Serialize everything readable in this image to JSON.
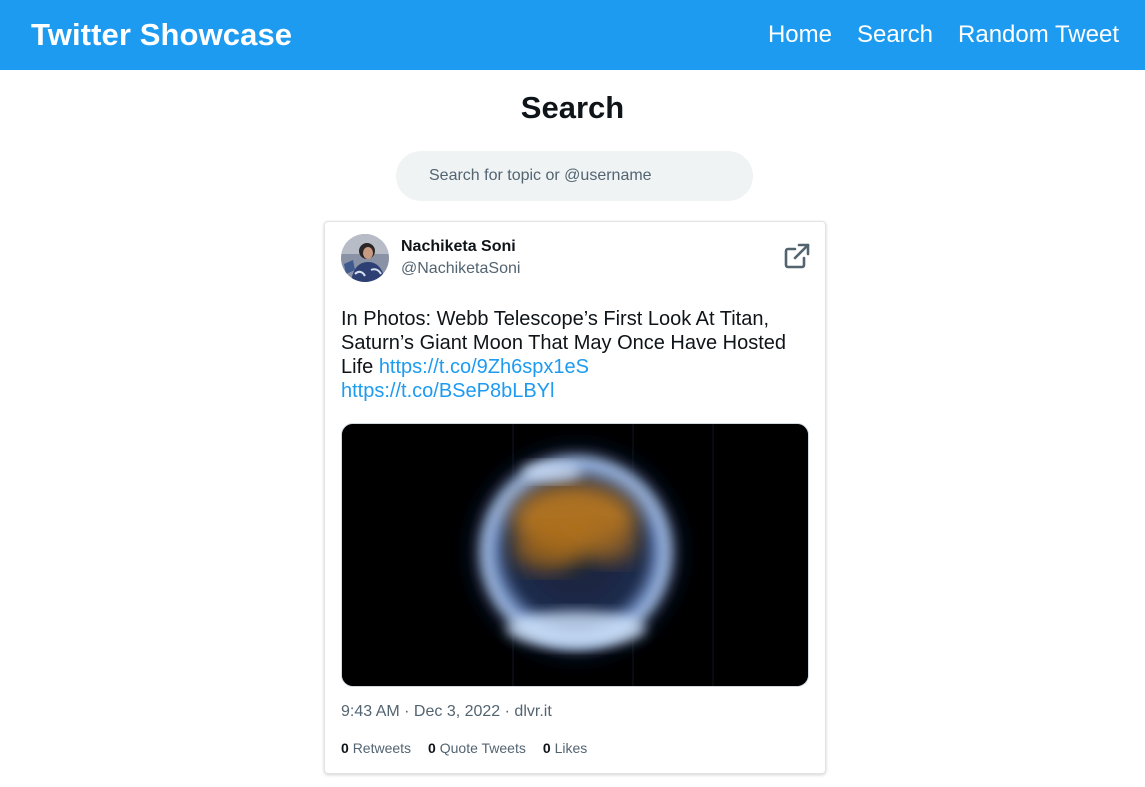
{
  "navbar": {
    "brand": "Twitter Showcase",
    "links": [
      "Home",
      "Search",
      "Random Tweet"
    ],
    "bg_color": "#1d9bf0"
  },
  "page": {
    "title": "Search"
  },
  "search": {
    "placeholder": "Search for topic or @username",
    "value": ""
  },
  "tweet": {
    "author_name": "Nachiketa Soni",
    "author_handle": "@NachiketaSoni",
    "text": "In Photos: Webb Telescope’s First Look At Titan, Saturn’s Giant Moon That May Once Have Hosted Life",
    "link1": "https://t.co/9Zh6spx1eS",
    "link2": "https://t.co/BSeP8bLBYl",
    "timestamp": "9:43 AM · Dec 3, 2022 · dlvr.it",
    "retweets": "0",
    "retweets_label": "Retweets",
    "quote_tweets": "0",
    "quote_tweets_label": "Quote Tweets",
    "likes": "0",
    "likes_label": "Likes",
    "icons": {
      "external": "external-link-icon",
      "avatar": "avatar"
    },
    "link_color": "#1d9bf0"
  }
}
